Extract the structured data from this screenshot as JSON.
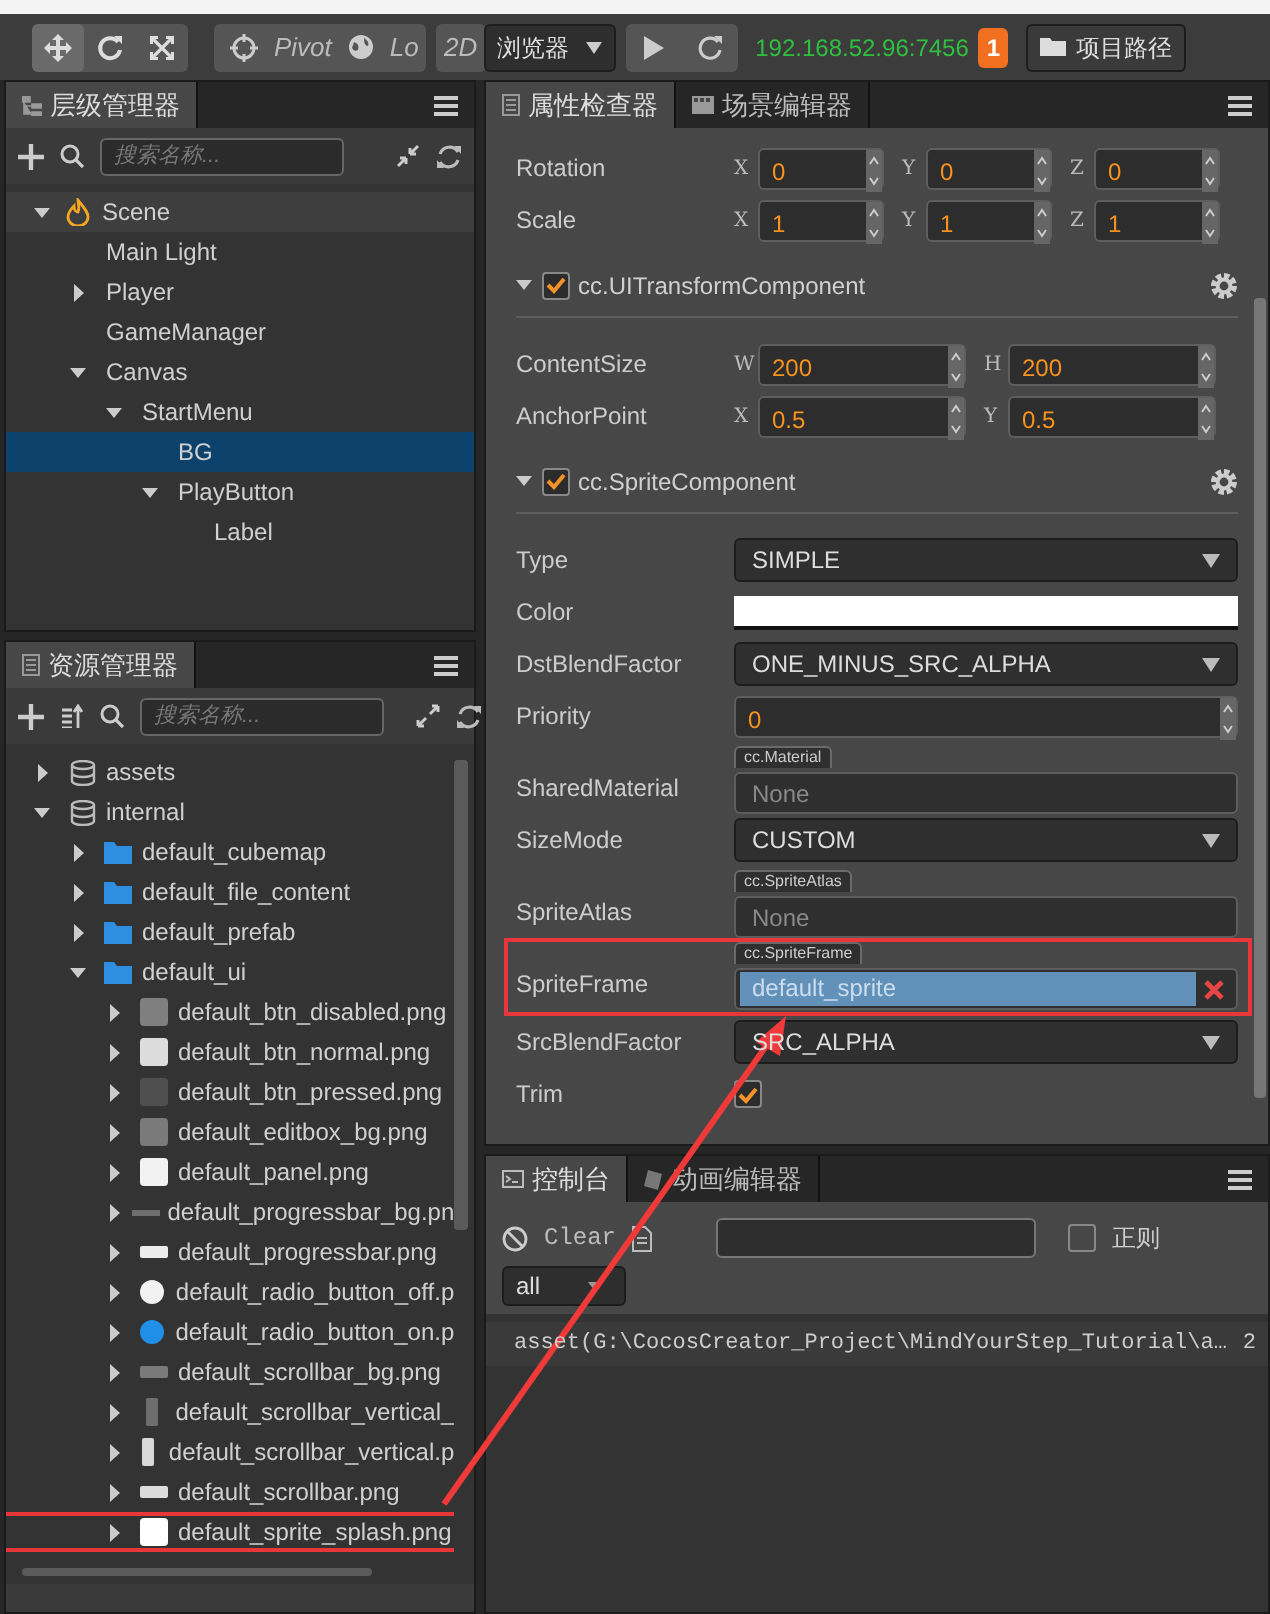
{
  "toolbar": {
    "transform_tools": [
      {
        "kind": "move",
        "selected": true
      },
      {
        "kind": "rotate",
        "selected": false
      },
      {
        "kind": "scale",
        "selected": false
      }
    ],
    "pivot_label": "Pivot",
    "coord_label": "Lo",
    "mode_2d": "2D",
    "preview_select": "浏览器",
    "address": "192.168.52.96:7456",
    "badge": "1",
    "project_button": "项目路径"
  },
  "hierarchy": {
    "tab": "层级管理器",
    "search_placeholder": "搜索名称...",
    "tree": [
      {
        "label": "Scene",
        "kind": "scene",
        "expanded": true,
        "selected": false,
        "children": [
          {
            "label": "Main Light",
            "selected": false
          },
          {
            "label": "Player",
            "expanded": false,
            "selected": false
          },
          {
            "label": "GameManager",
            "selected": false
          },
          {
            "label": "Canvas",
            "expanded": true,
            "selected": false,
            "children": [
              {
                "label": "StartMenu",
                "expanded": true,
                "selected": false,
                "children": [
                  {
                    "label": "BG",
                    "selected": true
                  },
                  {
                    "label": "PlayButton",
                    "expanded": true,
                    "selected": false,
                    "children": [
                      {
                        "label": "Label",
                        "selected": false
                      }
                    ]
                  }
                ]
              }
            ]
          }
        ]
      }
    ]
  },
  "assets": {
    "tab": "资源管理器",
    "search_placeholder": "搜索名称...",
    "tree": [
      {
        "label": "assets",
        "kind": "database",
        "expanded": false
      },
      {
        "label": "internal",
        "kind": "database",
        "expanded": true,
        "children": [
          {
            "label": "default_cubemap",
            "kind": "folder",
            "expanded": false
          },
          {
            "label": "default_file_content",
            "kind": "folder",
            "expanded": false
          },
          {
            "label": "default_prefab",
            "kind": "folder",
            "expanded": false
          },
          {
            "label": "default_ui",
            "kind": "folder",
            "expanded": true,
            "children": [
              {
                "label": "default_btn_disabled.png",
                "kind": "square",
                "color": "#7f7f7f",
                "expanded": false
              },
              {
                "label": "default_btn_normal.png",
                "kind": "square",
                "color": "#dcdcdc",
                "expanded": false
              },
              {
                "label": "default_btn_pressed.png",
                "kind": "square",
                "color": "#4f4f4f",
                "expanded": false
              },
              {
                "label": "default_editbox_bg.png",
                "kind": "square",
                "color": "#7a7a7a",
                "expanded": false
              },
              {
                "label": "default_panel.png",
                "kind": "square",
                "color": "#f2f2f2",
                "expanded": false
              },
              {
                "label": "default_progressbar_bg.pn",
                "kind": "line",
                "color": "#6e6e6e",
                "expanded": false
              },
              {
                "label": "default_progressbar.png",
                "kind": "bar",
                "color": "#ececec",
                "expanded": false
              },
              {
                "label": "default_radio_button_off.p",
                "kind": "circle",
                "color": "#f2f2f2",
                "expanded": false
              },
              {
                "label": "default_radio_button_on.p",
                "kind": "circle",
                "color": "#1e90e8",
                "expanded": false
              },
              {
                "label": "default_scrollbar_bg.png",
                "kind": "bar",
                "color": "#7a7a7a",
                "expanded": false
              },
              {
                "label": "default_scrollbar_vertical_",
                "kind": "vertical",
                "color": "#6e6e6e",
                "expanded": false
              },
              {
                "label": "default_scrollbar_vertical.p",
                "kind": "vertical",
                "color": "#d8d8d8",
                "expanded": false
              },
              {
                "label": "default_scrollbar.png",
                "kind": "bar",
                "color": "#dcdcdc",
                "expanded": false
              },
              {
                "label": "default_sprite_splash.png",
                "kind": "square",
                "color": "#ffffff",
                "expanded": false,
                "highlighted": true
              }
            ]
          }
        ]
      }
    ]
  },
  "inspector": {
    "tabs": [
      {
        "label": "属性检查器",
        "selected": true
      },
      {
        "label": "场景编辑器",
        "selected": false
      }
    ],
    "items": [
      {
        "kind": "vec",
        "label": "Rotation",
        "fields": [
          {
            "axis": "X",
            "value": "0"
          },
          {
            "axis": "Y",
            "value": "0"
          },
          {
            "axis": "Z",
            "value": "0"
          }
        ]
      },
      {
        "kind": "vec",
        "label": "Scale",
        "fields": [
          {
            "axis": "X",
            "value": "1"
          },
          {
            "axis": "Y",
            "value": "1"
          },
          {
            "axis": "Z",
            "value": "1"
          }
        ]
      },
      {
        "kind": "header",
        "title": "cc.UITransformComponent",
        "checked": true,
        "expanded": true
      },
      {
        "kind": "vec",
        "label": "ContentSize",
        "fields": [
          {
            "axis": "W",
            "value": "200"
          },
          {
            "axis": "H",
            "value": "200"
          }
        ]
      },
      {
        "kind": "vec",
        "label": "AnchorPoint",
        "fields": [
          {
            "axis": "X",
            "value": "0.5"
          },
          {
            "axis": "Y",
            "value": "0.5"
          }
        ]
      },
      {
        "kind": "header",
        "title": "cc.SpriteComponent",
        "checked": true,
        "expanded": true
      },
      {
        "kind": "select",
        "label": "Type",
        "value": "SIMPLE"
      },
      {
        "kind": "color",
        "label": "Color",
        "color": "#ffffff"
      },
      {
        "kind": "select",
        "label": "DstBlendFactor",
        "value": "ONE_MINUS_SRC_ALPHA"
      },
      {
        "kind": "number",
        "label": "Priority",
        "value": "0"
      },
      {
        "kind": "asset",
        "label": "SharedMaterial",
        "type_tag": "cc.Material",
        "placeholder": "None"
      },
      {
        "kind": "select",
        "label": "SizeMode",
        "value": "CUSTOM"
      },
      {
        "kind": "asset",
        "label": "SpriteAtlas",
        "type_tag": "cc.SpriteAtlas",
        "placeholder": "None"
      },
      {
        "kind": "asset",
        "label": "SpriteFrame",
        "type_tag": "cc.SpriteFrame",
        "value": "default_sprite",
        "highlighted": true
      },
      {
        "kind": "select",
        "label": "SrcBlendFactor",
        "value": "SRC_ALPHA"
      },
      {
        "kind": "checkbox",
        "label": "Trim",
        "checked": true
      }
    ]
  },
  "console": {
    "tabs": [
      {
        "label": "控制台",
        "selected": true
      },
      {
        "label": "动画编辑器",
        "selected": false
      }
    ],
    "clear_button": "Clear",
    "regex": {
      "label": "正则",
      "checked": false
    },
    "level_select": "all",
    "logs": [
      {
        "text": "asset(G:\\CocosCreator_Project\\MindYourStep_Tutorial\\a…",
        "count": "2"
      }
    ]
  }
}
